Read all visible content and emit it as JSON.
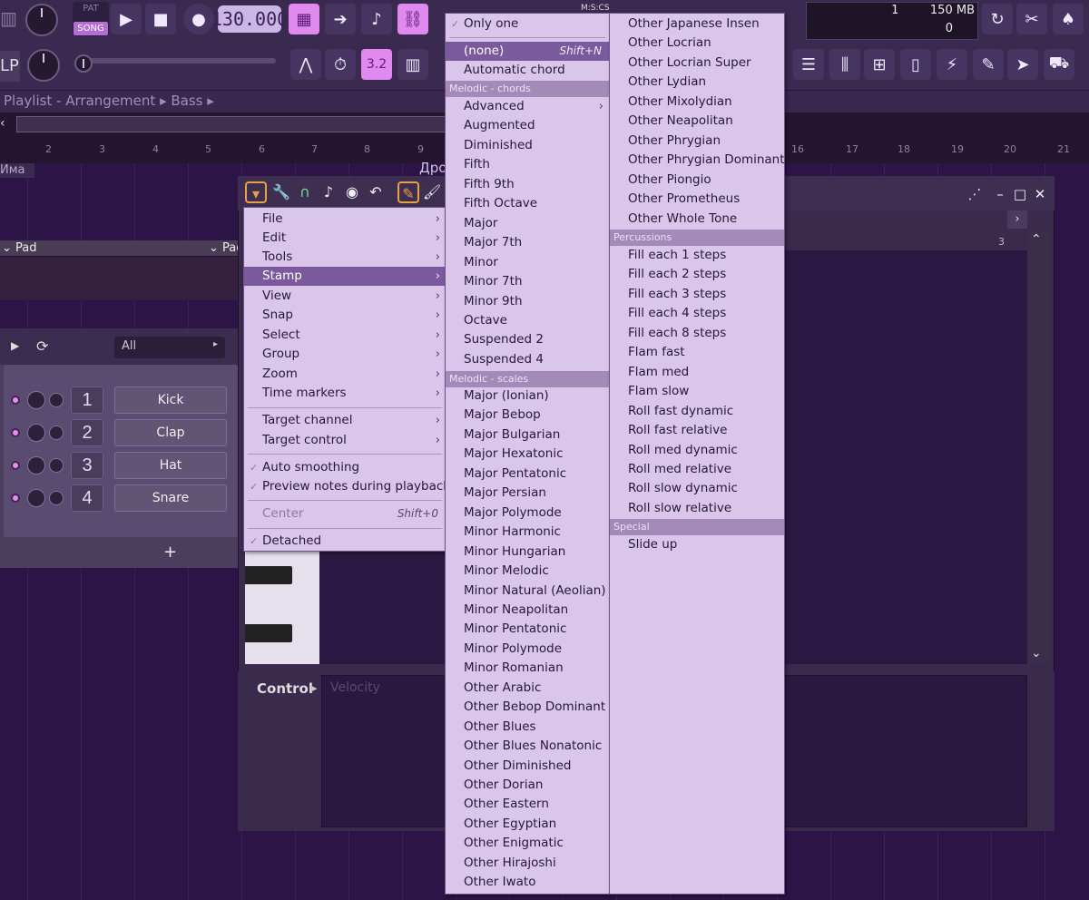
{
  "toolbar": {
    "pat_label": "PAT",
    "song_label": "SONG",
    "tempo": "130.000",
    "time_label": "M:S:CS",
    "cpu": "1",
    "memory": "150 MB",
    "polyphony": "0",
    "snap_label": "3.2",
    "left_label": "LP"
  },
  "playlist": {
    "title": "Playlist - Arrangement",
    "crumb1": "Bass",
    "ruler": [
      "2",
      "3",
      "4",
      "5",
      "6",
      "7",
      "8",
      "9",
      "16",
      "17",
      "18",
      "19",
      "20",
      "21"
    ],
    "track_name": "Има",
    "partial_label": "Дро",
    "pattern1": "Pad",
    "pattern2": "Pad"
  },
  "channel_rack": {
    "filter": "All",
    "channels": [
      {
        "num": "1",
        "name": "Kick"
      },
      {
        "num": "2",
        "name": "Clap"
      },
      {
        "num": "3",
        "name": "Hat"
      },
      {
        "num": "4",
        "name": "Snare"
      }
    ],
    "add": "+"
  },
  "piano_roll": {
    "control_label": "Control",
    "control_target": "Velocity",
    "bar_number": "3"
  },
  "main_menu": {
    "items": [
      {
        "label": "File"
      },
      {
        "label": "Edit"
      },
      {
        "label": "Tools"
      },
      {
        "label": "Stamp"
      },
      {
        "label": "View"
      },
      {
        "label": "Snap"
      },
      {
        "label": "Select"
      },
      {
        "label": "Group"
      },
      {
        "label": "Zoom"
      },
      {
        "label": "Time markers"
      },
      {
        "label": "Target channel"
      },
      {
        "label": "Target control"
      },
      {
        "label": "Auto smoothing"
      },
      {
        "label": "Preview notes during playback"
      },
      {
        "label": "Center",
        "shortcut": "Shift+0"
      },
      {
        "label": "Detached"
      }
    ]
  },
  "stamp_menu": {
    "only_one": "Only one",
    "none": "(none)",
    "none_shortcut": "Shift+N",
    "automatic_chord": "Automatic chord",
    "section_chords": "Melodic - chords",
    "chords": [
      "Advanced",
      "Augmented",
      "Diminished",
      "Fifth",
      "Fifth 9th",
      "Fifth Octave",
      "Major",
      "Major 7th",
      "Minor",
      "Minor 7th",
      "Minor 9th",
      "Octave",
      "Suspended 2",
      "Suspended 4"
    ],
    "section_scales": "Melodic - scales",
    "scales": [
      "Major (Ionian)",
      "Major Bebop",
      "Major Bulgarian",
      "Major Hexatonic",
      "Major Pentatonic",
      "Major Persian",
      "Major Polymode",
      "Minor Harmonic",
      "Minor Hungarian",
      "Minor Melodic",
      "Minor Natural (Aeolian)",
      "Minor Neapolitan",
      "Minor Pentatonic",
      "Minor Polymode",
      "Minor Romanian",
      "Other Arabic",
      "Other Bebop Dominant",
      "Other Blues",
      "Other Blues Nonatonic",
      "Other Diminished",
      "Other Dorian",
      "Other Eastern",
      "Other Egyptian",
      "Other Enigmatic",
      "Other Hirajoshi",
      "Other Iwato"
    ]
  },
  "stamp_menu2": {
    "scales_cont": [
      "Other Japanese Insen",
      "Other Locrian",
      "Other Locrian Super",
      "Other Lydian",
      "Other Mixolydian",
      "Other Neapolitan",
      "Other Phrygian",
      "Other Phrygian Dominant",
      "Other Piongio",
      "Other Prometheus",
      "Other Whole Tone"
    ],
    "section_perc": "Percussions",
    "percussions": [
      "Fill each 1 steps",
      "Fill each 2 steps",
      "Fill each 3 steps",
      "Fill each 4 steps",
      "Fill each 8 steps",
      "Flam fast",
      "Flam med",
      "Flam slow",
      "Roll fast dynamic",
      "Roll fast relative",
      "Roll med dynamic",
      "Roll med relative",
      "Roll slow dynamic",
      "Roll slow relative"
    ],
    "section_special": "Special",
    "special": [
      "Slide up"
    ]
  }
}
